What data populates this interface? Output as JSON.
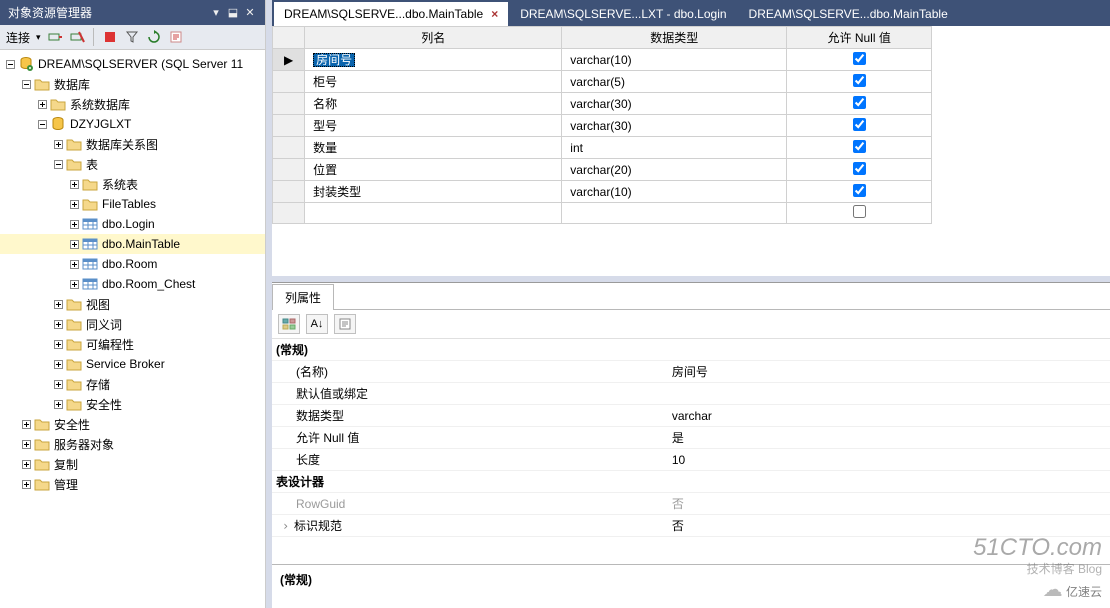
{
  "sidebar": {
    "title": "对象资源管理器",
    "connect_label": "连接",
    "server": "DREAM\\SQLSERVER (SQL Server 11",
    "nodes": {
      "databases": "数据库",
      "sysdb": "系统数据库",
      "userdb": "DZYJGLXT",
      "diagrams": "数据库关系图",
      "tables": "表",
      "systables": "系统表",
      "filetables": "FileTables",
      "t1": "dbo.Login",
      "t2": "dbo.MainTable",
      "t3": "dbo.Room",
      "t4": "dbo.Room_Chest",
      "views": "视图",
      "synonyms": "同义词",
      "prog": "可编程性",
      "sb": "Service Broker",
      "storage": "存储",
      "sec_db": "安全性",
      "sec": "安全性",
      "so": "服务器对象",
      "repl": "复制",
      "mgmt": "管理"
    }
  },
  "tabs": [
    {
      "label": "DREAM\\SQLSERVE...dbo.MainTable",
      "active": true
    },
    {
      "label": "DREAM\\SQLSERVE...LXT - dbo.Login",
      "active": false
    },
    {
      "label": "DREAM\\SQLSERVE...dbo.MainTable",
      "active": false
    }
  ],
  "grid": {
    "headers": {
      "col": "列名",
      "type": "数据类型",
      "null": "允许 Null 值"
    },
    "rows": [
      {
        "name": "房间号",
        "type": "varchar(10)",
        "null": true,
        "selected": true
      },
      {
        "name": "柜号",
        "type": "varchar(5)",
        "null": true
      },
      {
        "name": "名称",
        "type": "varchar(30)",
        "null": true
      },
      {
        "name": "型号",
        "type": "varchar(30)",
        "null": true
      },
      {
        "name": "数量",
        "type": "int",
        "null": true
      },
      {
        "name": "位置",
        "type": "varchar(20)",
        "null": true
      },
      {
        "name": "封装类型",
        "type": "varchar(10)",
        "null": true
      }
    ]
  },
  "props": {
    "tab": "列属性",
    "cat_general": "(常规)",
    "name_k": "(名称)",
    "name_v": "房间号",
    "default_k": "默认值或绑定",
    "default_v": "",
    "type_k": "数据类型",
    "type_v": "varchar",
    "null_k": "允许 Null 值",
    "null_v": "是",
    "len_k": "长度",
    "len_v": "10",
    "cat_designer": "表设计器",
    "rowguid_k": "RowGuid",
    "rowguid_v": "否",
    "identity_k": "标识规范",
    "identity_v": "否",
    "desc_title": "(常规)"
  },
  "watermark": {
    "big": "51CTO.com",
    "small": "技术博客   Blog",
    "brand": "亿速云"
  }
}
